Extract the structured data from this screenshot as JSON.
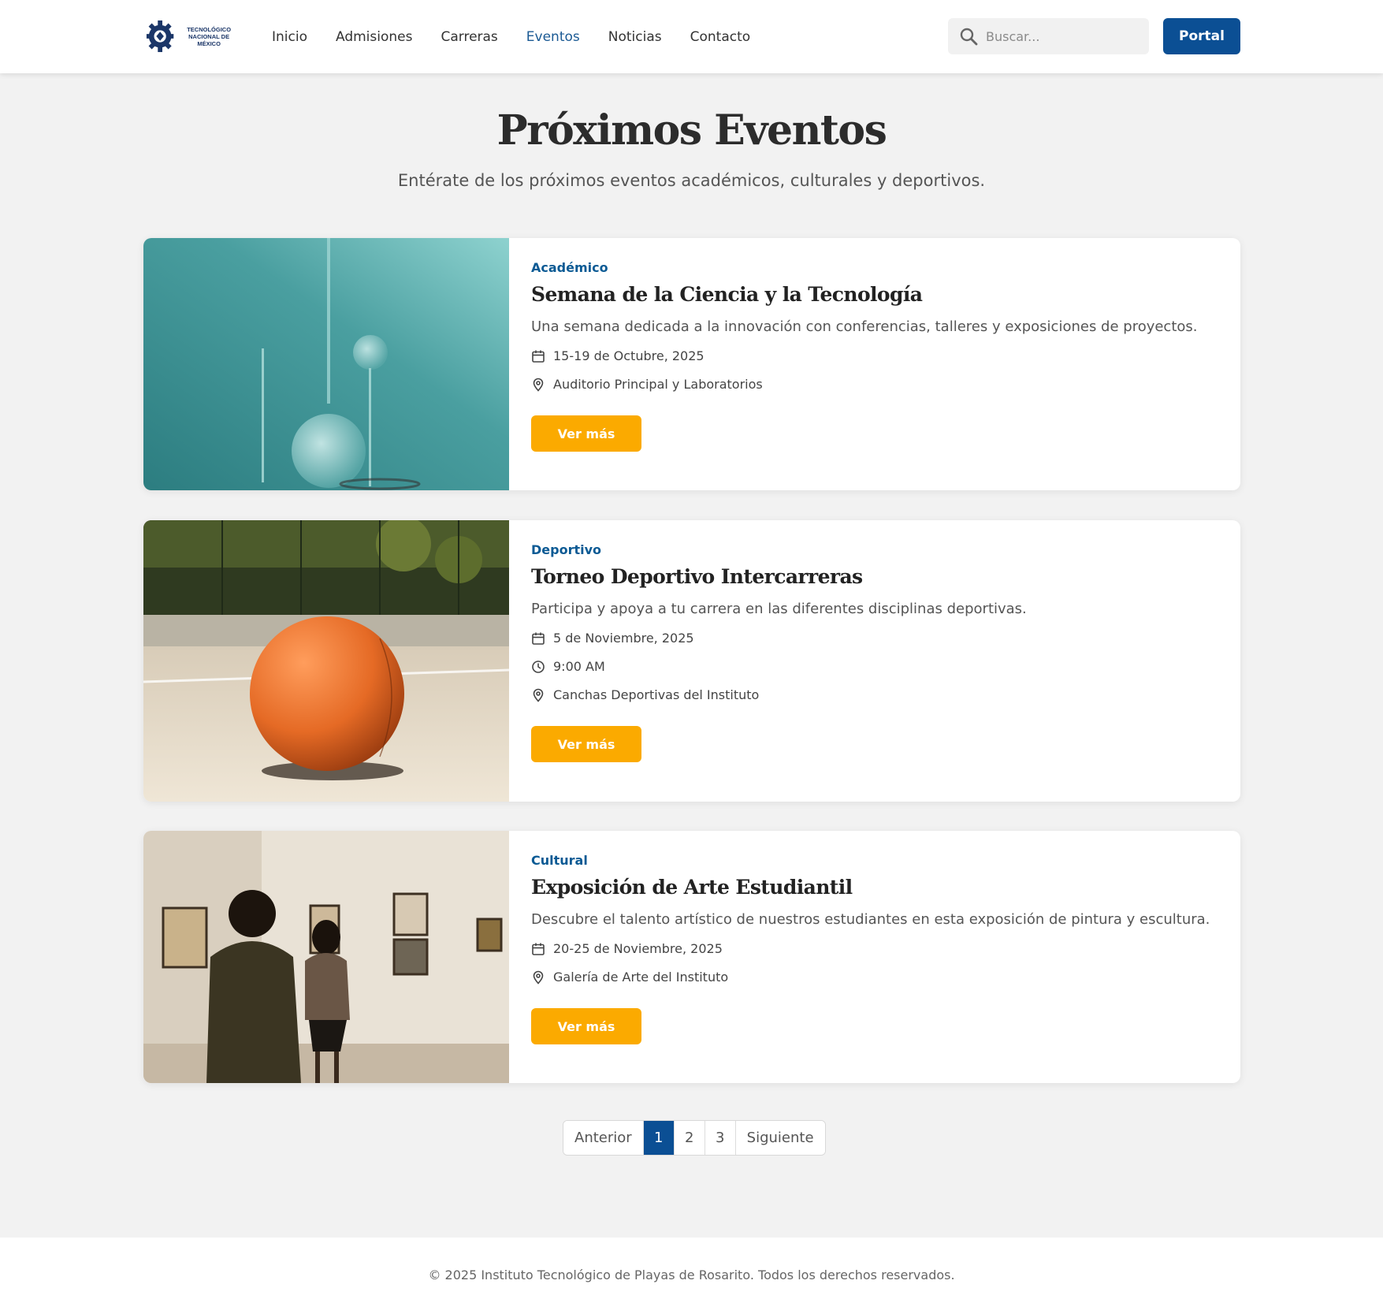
{
  "header": {
    "logo_text_line1": "TECNOLÓGICO",
    "logo_text_line2": "NACIONAL DE MÉXICO",
    "nav": [
      {
        "label": "Inicio",
        "active": false
      },
      {
        "label": "Admisiones",
        "active": false
      },
      {
        "label": "Carreras",
        "active": false
      },
      {
        "label": "Eventos",
        "active": true
      },
      {
        "label": "Noticias",
        "active": false
      },
      {
        "label": "Contacto",
        "active": false
      }
    ],
    "search_placeholder": "Buscar...",
    "portal_label": "Portal"
  },
  "hero": {
    "title": "Próximos Eventos",
    "subtitle": "Entérate de los próximos eventos académicos, culturales y deportivos."
  },
  "events": [
    {
      "category": "Académico",
      "title": "Semana de la Ciencia y la Tecnología",
      "description": "Una semana dedicada a la innovación con conferencias, talleres y exposiciones de proyectos.",
      "date": "15-19 de Octubre, 2025",
      "location": "Auditorio Principal y Laboratorios",
      "button": "Ver más"
    },
    {
      "category": "Deportivo",
      "title": "Torneo Deportivo Intercarreras",
      "description": "Participa y apoya a tu carrera en las diferentes disciplinas deportivas.",
      "date": "5 de Noviembre, 2025",
      "time": "9:00 AM",
      "location": "Canchas Deportivas del Instituto",
      "button": "Ver más"
    },
    {
      "category": "Cultural",
      "title": "Exposición de Arte Estudiantil",
      "description": "Descubre el talento artístico de nuestros estudiantes en esta exposición de pintura y escultura.",
      "date": "20-25 de Noviembre, 2025",
      "location": "Galería de Arte del Instituto",
      "button": "Ver más"
    }
  ],
  "pagination": {
    "prev": "Anterior",
    "pages": [
      "1",
      "2",
      "3"
    ],
    "current": "1",
    "next": "Siguiente"
  },
  "footer": {
    "text": "© 2025 Instituto Tecnológico de Playas de Rosarito. Todos los derechos reservados."
  },
  "colors": {
    "primary": "#0b4f94",
    "accent": "#fbaa00",
    "category": "#0b5a94",
    "background": "#f2f2f2"
  }
}
